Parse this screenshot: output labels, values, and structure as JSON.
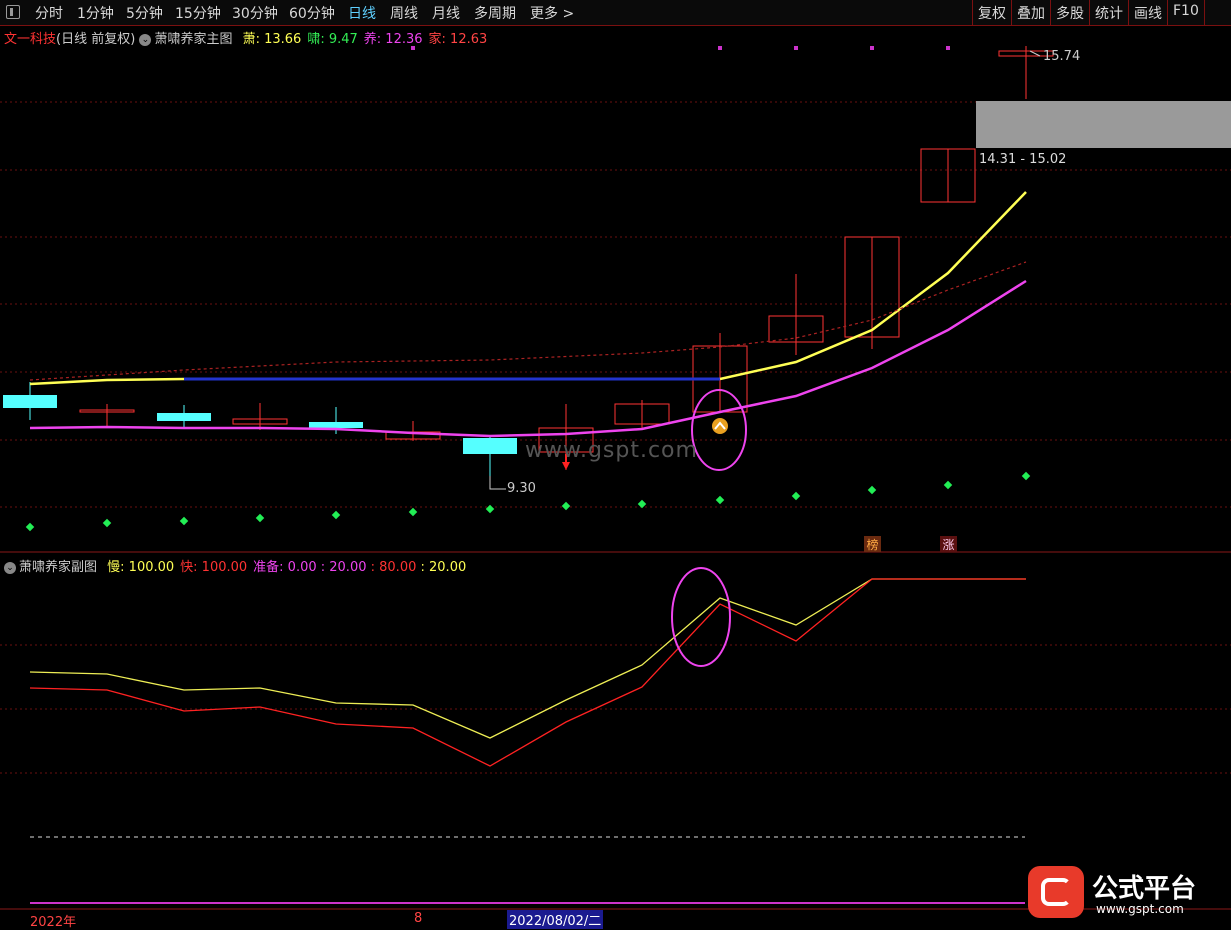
{
  "toolbar": {
    "periods": [
      "分时",
      "1分钟",
      "5分钟",
      "15分钟",
      "30分钟",
      "60分钟",
      "日线",
      "周线",
      "月线",
      "多周期",
      "更多"
    ],
    "active_period": "日线",
    "right_buttons": [
      "复权",
      "叠加",
      "多股",
      "统计",
      "画线",
      "F10"
    ]
  },
  "main_panel": {
    "stock_name": "文一科技",
    "mode": "(日线 前复权)",
    "indicator_name": "萧啸养家主图",
    "values": [
      {
        "label": "萧",
        "value": "13.66",
        "color": "#ffff55"
      },
      {
        "label": "啸",
        "value": "9.47",
        "color": "#33ee55"
      },
      {
        "label": "养",
        "value": "12.36",
        "color": "#ee44ee"
      },
      {
        "label": "家",
        "value": "12.63",
        "color": "#ff4444"
      }
    ],
    "high_label": "15.74",
    "low_label": "9.30",
    "range_label": "14.31 - 15.02",
    "watermark": "www.gspt.com",
    "tags": [
      "榜",
      "涨"
    ]
  },
  "sub_panel": {
    "indicator_name": "萧啸养家副图",
    "values": [
      {
        "label": "慢",
        "value": "100.00",
        "color": "#ffff55"
      },
      {
        "label": "快",
        "value": "100.00",
        "color": "#ff3333"
      },
      {
        "label": "准备",
        "value": "0.00",
        "color": "#ee44ee"
      }
    ],
    "extras": [
      {
        "value": "20.00",
        "color": "#ee44ee"
      },
      {
        "value": "80.00",
        "color": "#ff3333"
      },
      {
        "value": "20.00",
        "color": "#ffff55"
      }
    ]
  },
  "bottom_axis": {
    "year_label": "2022年",
    "month_label": "8",
    "cursor_date": "2022/08/02/二"
  },
  "logo": {
    "name": "公式平台",
    "url_text": "www.gspt.com"
  },
  "colors": {
    "up_candle": "#ff3333",
    "down_candle": "#55ffff",
    "fast_line": "#ffff55",
    "slow_line": "#ee44ee",
    "grid": "#6a1010",
    "highlight": "#ee44ee"
  }
}
